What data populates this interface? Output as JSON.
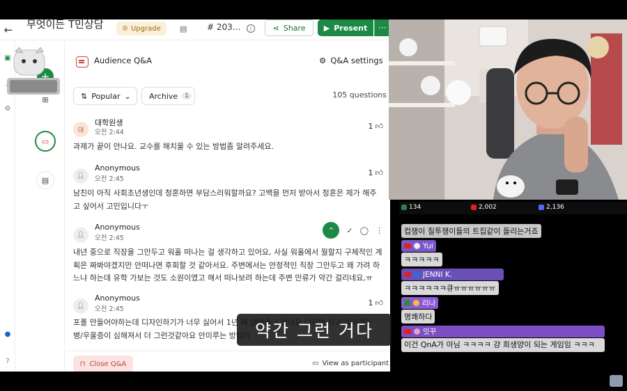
{
  "app": {
    "title": "무엇이든 T민상담",
    "upgrade_label": "Upgrade",
    "hash_label": "# 203...",
    "share_label": "Share",
    "present_label": "Present",
    "more_label": "···",
    "accent": "#1c8a44"
  },
  "panel": {
    "title": "Audience Q&A",
    "settings_label": "Q&A settings",
    "filter_popular": "Popular",
    "filter_archive": "Archive",
    "archive_count": "1",
    "question_count": "105 questions",
    "close_label": "Close Q&A",
    "view_label": "View as participant"
  },
  "questions": [
    {
      "avatar": "대",
      "name": "대학원생",
      "time": "오전 2:44",
      "likes": "1",
      "text": "과제가 끝이 안나요. 교수를 해치울 수 있는 방법좀 알려주세요."
    },
    {
      "avatar": "",
      "name": "Anonymous",
      "time": "오전 2:45",
      "likes": "1",
      "text": "남친이 아직 사회초년생인데 청혼하면 부담스러워할까요? 고백을 먼저 받아서 청혼은 제가 해주고 싶어서 고민입니다ㅜ"
    },
    {
      "avatar": "",
      "name": "Anonymous",
      "time": "오전 2:45",
      "likes": "",
      "text": "내년 중으로 직장을 그만두고 워홀 떠나는 걸 생각하고 있어요, 사실 워홀에서 뭘할지 구체적인 계획은 짜봐야겠지만 안떠나면 후회할 것 같아서요. 주변에서는 안정적인 직장 그만두고 왜 가려 하느냐 하는데 유학 가보는 것도 소원이였고 해서 떠나보려 하는데 주변 만류가 약간 걸리네요,ㅠ"
    },
    {
      "avatar": "",
      "name": "Anonymous",
      "time": "오전 2:45",
      "likes": "1",
      "text": "포폴 만들어야하는데 디자인하기가 너무 싫어서 1년 째 안만들고 있어요 디자인 하기 싫어하는 병/우울증이 심해져서 더 그런것같아요 안미루는 방법이"
    }
  ],
  "subtitle": "약간 그런 거다",
  "chat": {
    "stats": [
      {
        "label": "134",
        "color": "#2e7d4f"
      },
      {
        "label": "2,002",
        "color": "#e02020"
      },
      {
        "label": "2,136",
        "color": "#5865f2"
      }
    ],
    "first_message": "컵쟁이 질투쟁이들의 트집같이 들리는거죠",
    "messages": [
      {
        "user": "Yui",
        "color": "#7b57c9",
        "text": "ㅋㅋㅋㅋㅋ"
      },
      {
        "user": "JENNI K.",
        "color": "#6a4fb8",
        "text": "ㅋㅋㅋㅋㅋㅋ큐ㅠㅠㅠㅠㅠㅠ"
      },
      {
        "user": "리나",
        "color": "#8f5ad6",
        "text": "명쾌하다"
      },
      {
        "user": "잇꾸",
        "color": "#7d4fc4",
        "text": "이건 QnA가 아님 ㅋㅋㅋㅋ 걍 희생양이 되는 게임임 ㅋㅋㅋ"
      }
    ]
  }
}
